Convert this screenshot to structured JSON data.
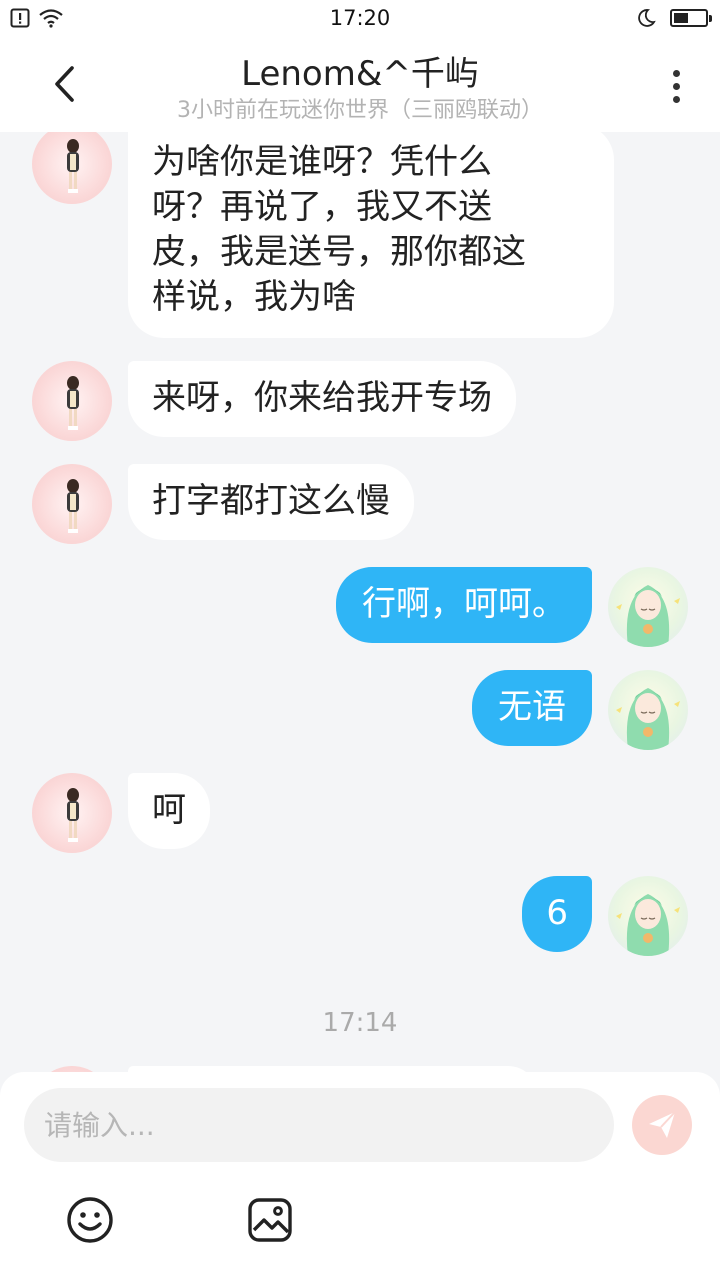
{
  "status_bar": {
    "time": "17:20",
    "icons": [
      "alert-icon",
      "wifi-icon",
      "moon-icon",
      "battery-icon"
    ],
    "battery_level": 0.45
  },
  "header": {
    "title": "Lenom&^千屿",
    "subtitle": "3小时前在玩迷你世界（三丽鸥联动）",
    "back_icon": "chevron-left-icon",
    "more_icon": "more-vertical-icon"
  },
  "messages": [
    {
      "from": "other",
      "text": "为啥你是谁呀？凭什么\n呀？再说了，我又不送\n皮，我是送号，那你都这\n样说，我为啥"
    },
    {
      "from": "other",
      "text": "来呀，你来给我开专场"
    },
    {
      "from": "other",
      "text": "打字都打这么慢"
    },
    {
      "from": "me",
      "text": "行啊，呵呵。"
    },
    {
      "from": "me",
      "text": "无语"
    },
    {
      "from": "other",
      "text": "呵"
    },
    {
      "from": "me",
      "text": "6"
    }
  ],
  "timestamp": "17:14",
  "composer": {
    "placeholder": "请输入...",
    "send_icon": "send-icon",
    "emoji_icon": "smiley-icon",
    "image_icon": "image-icon"
  },
  "colors": {
    "outgoing_bubble": "#2fb5f6",
    "incoming_bubble": "#ffffff",
    "background": "#f4f5f7",
    "send_button": "#fbd7d2"
  }
}
